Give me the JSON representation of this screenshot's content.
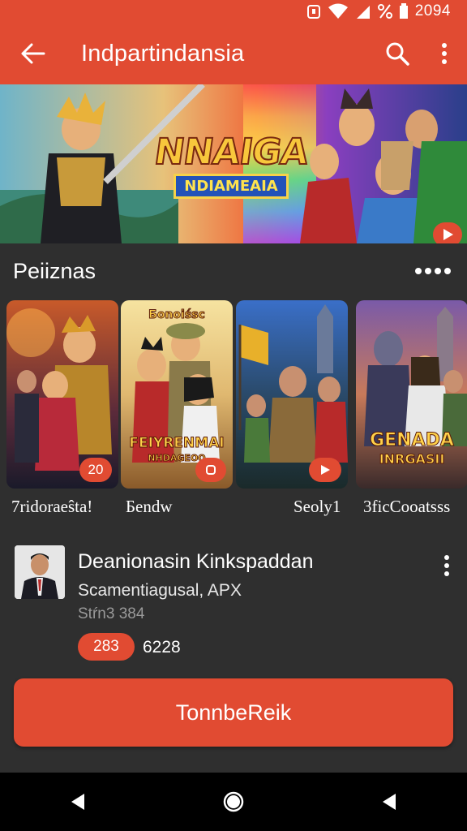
{
  "status_bar": {
    "time": "2094",
    "icons": [
      "alarm-icon",
      "wifi-icon",
      "signal-icon",
      "percent-icon",
      "battery-icon"
    ]
  },
  "app_bar": {
    "title": "Indpartindansia",
    "back_icon": "arrow-left-icon",
    "actions": [
      "search-icon",
      "more-vert-icon"
    ]
  },
  "banner": {
    "title_main": "NNAIGA",
    "title_sub": "NDIAMEAIA",
    "play_icon": "play-icon"
  },
  "section": {
    "title": "Peiiznas",
    "more_icon": "more-horiz-icon"
  },
  "cards": [
    {
      "label": "7ridoraeŝta!",
      "badge": "20",
      "logo": ""
    },
    {
      "label": "Бendw",
      "badge": "",
      "logo_top": "Бonoiśsc",
      "logo": "FEIYRENMAI",
      "logo_sub": "NHDAGEOO"
    },
    {
      "label": "Seoly1",
      "badge": "",
      "logo": ""
    },
    {
      "label": "3ficCooatsss",
      "badge": "",
      "logo": "GENADA",
      "logo_sub": "INRGASII"
    }
  ],
  "publisher": {
    "name": "Deanionasin Kinkspaddan",
    "subtitle": "Scamentiagusal, APX",
    "meta": "Stŕn3 384",
    "pill": "283",
    "count": "6228",
    "menu_icon": "more-vert-icon"
  },
  "cta": {
    "label": "TonnbeReik"
  },
  "nav": {
    "buttons": [
      "back-triangle-icon",
      "home-circle-icon",
      "recent-triangle-icon"
    ]
  },
  "colors": {
    "accent": "#e14b32",
    "background": "#2f2f2f",
    "nav": "#000000"
  }
}
